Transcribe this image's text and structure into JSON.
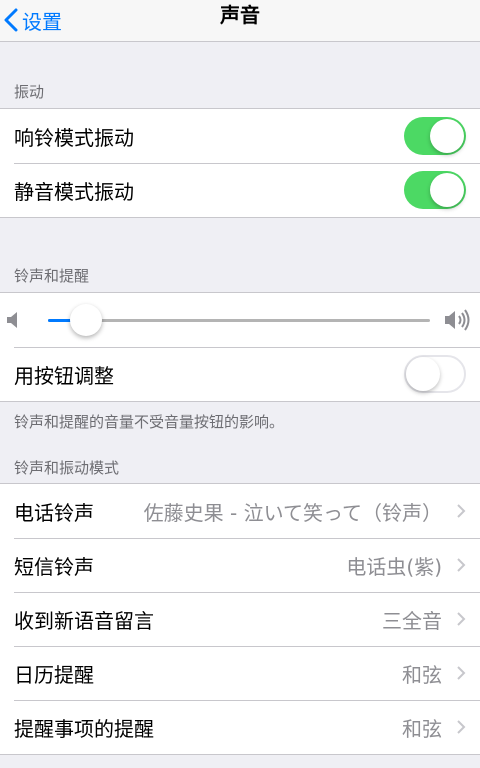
{
  "nav": {
    "back_label": "设置",
    "title": "声音"
  },
  "vibration": {
    "header": "振动",
    "items": [
      {
        "label": "响铃模式振动",
        "on": true
      },
      {
        "label": "静音模式振动",
        "on": true
      }
    ]
  },
  "ringer": {
    "header": "铃声和提醒",
    "volume_level": 0.1,
    "change_with_buttons": {
      "label": "用按钮调整",
      "on": false
    },
    "footer": "铃声和提醒的音量不受音量按钮的影响。"
  },
  "patterns": {
    "header": "铃声和振动模式",
    "items": [
      {
        "label": "电话铃声",
        "value": "佐藤史果 - 泣いて笑って（铃声）"
      },
      {
        "label": "短信铃声",
        "value": "电话虫(紫)"
      },
      {
        "label": "收到新语音留言",
        "value": "三全音"
      },
      {
        "label": "日历提醒",
        "value": "和弦"
      },
      {
        "label": "提醒事项的提醒",
        "value": "和弦"
      }
    ]
  },
  "colors": {
    "accent": "#007aff",
    "switch_on": "#4cd964",
    "background": "#efeff4"
  }
}
